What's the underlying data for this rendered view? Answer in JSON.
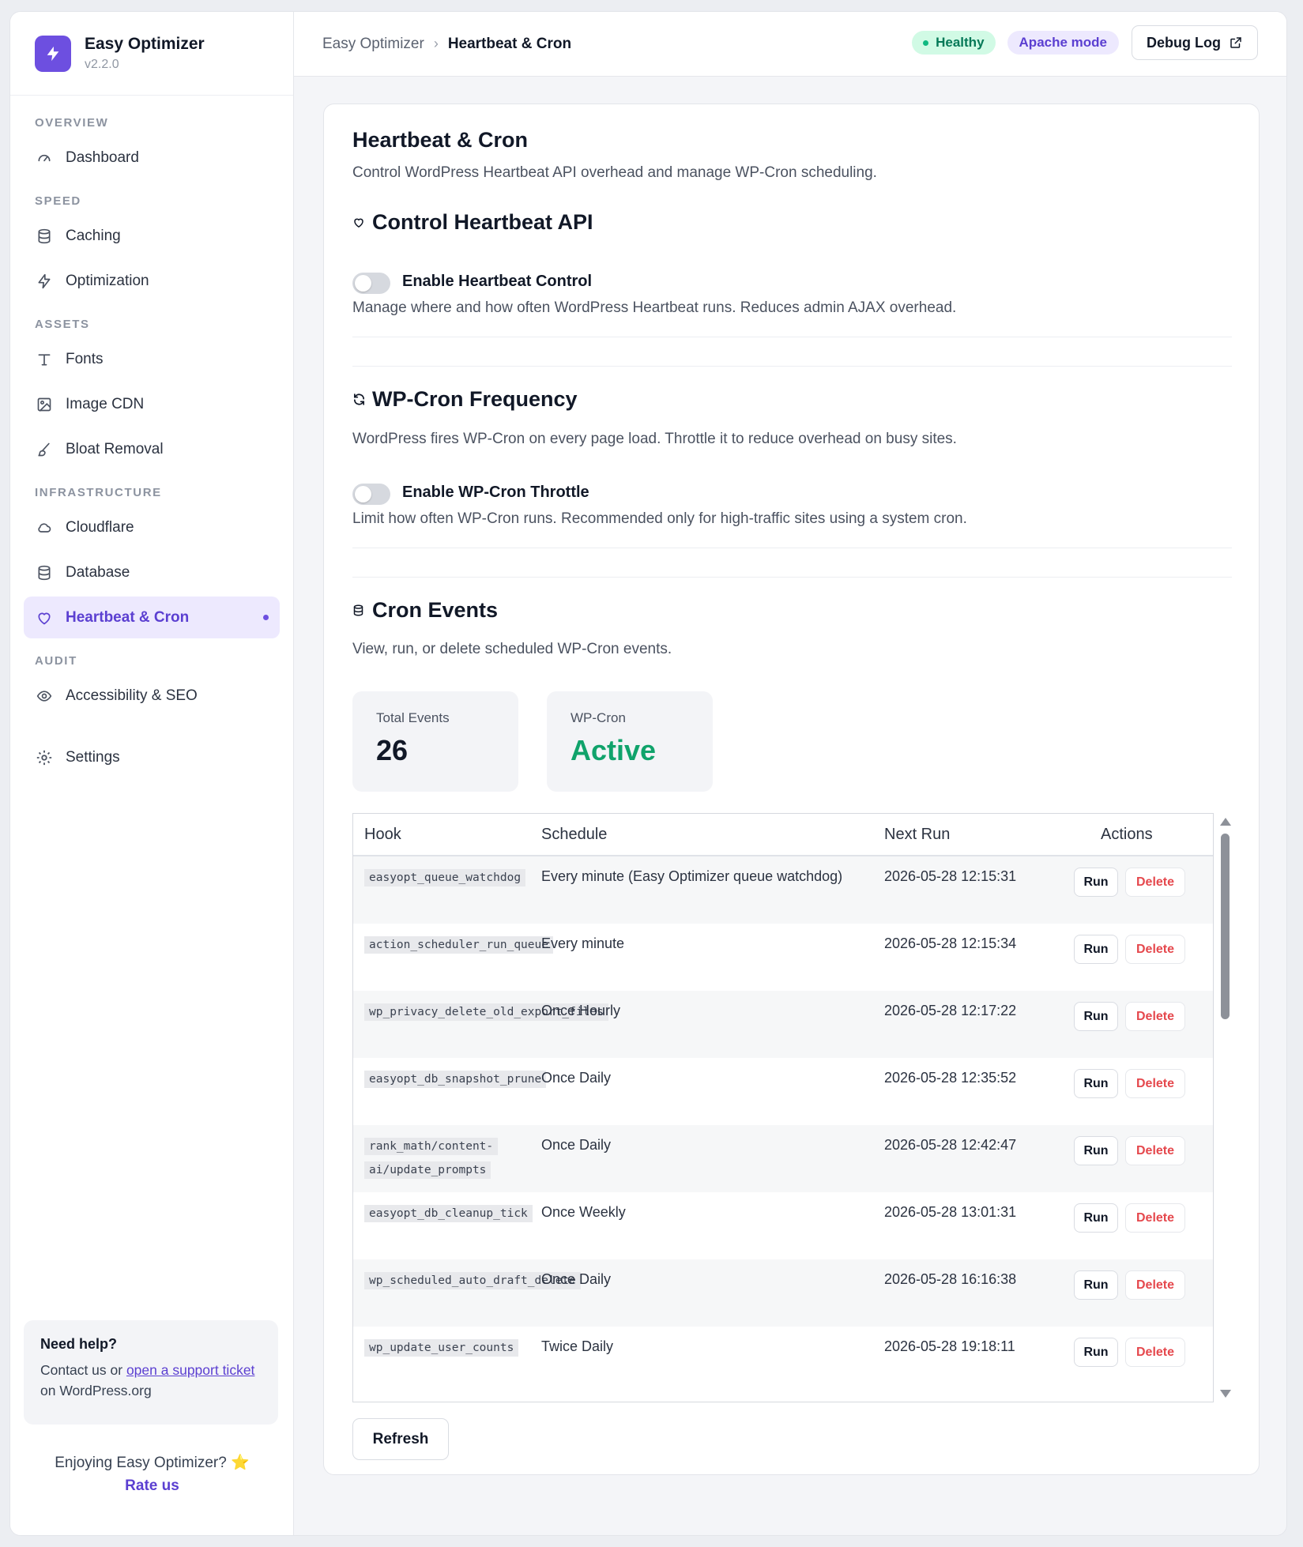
{
  "brand": {
    "name": "Easy Optimizer",
    "version": "v2.2.0"
  },
  "nav": {
    "overview": "OVERVIEW",
    "dashboard": "Dashboard",
    "speed": "SPEED",
    "caching": "Caching",
    "optimization": "Optimization",
    "assets": "ASSETS",
    "fonts": "Fonts",
    "image_cdn": "Image CDN",
    "bloat_removal": "Bloat Removal",
    "infrastructure": "INFRASTRUCTURE",
    "cloudflare": "Cloudflare",
    "database": "Database",
    "heartbeat_cron": "Heartbeat & Cron",
    "audit": "AUDIT",
    "accessibility_seo": "Accessibility & SEO",
    "settings": "Settings"
  },
  "help": {
    "title": "Need help?",
    "text_before": "Contact us or ",
    "link": "open a support ticket",
    "text_after": " on WordPress.org"
  },
  "footer": {
    "enjoy": "Enjoying Easy Optimizer? ⭐",
    "rate": "Rate us"
  },
  "header": {
    "crumb_root": "Easy Optimizer",
    "crumb_sep": "›",
    "crumb_current": "Heartbeat & Cron",
    "status": "Healthy",
    "mode": "Apache mode",
    "debug_log": "Debug Log"
  },
  "page": {
    "title": "Heartbeat & Cron",
    "description": "Control WordPress Heartbeat API overhead and manage WP-Cron scheduling."
  },
  "heartbeat": {
    "title": "Control Heartbeat API",
    "toggle_label": "Enable Heartbeat Control",
    "toggle_desc": "Manage where and how often WordPress Heartbeat runs. Reduces admin AJAX overhead.",
    "enabled": false
  },
  "wpcron": {
    "title": "WP-Cron Frequency",
    "description": "WordPress fires WP-Cron on every page load. Throttle it to reduce overhead on busy sites.",
    "toggle_label": "Enable WP-Cron Throttle",
    "toggle_desc": "Limit how often WP-Cron runs. Recommended only for high-traffic sites using a system cron.",
    "enabled": false
  },
  "cron_events": {
    "title": "Cron Events",
    "description": "View, run, or delete scheduled WP-Cron events.",
    "stats": {
      "total_label": "Total Events",
      "total_value": "26",
      "wpcron_label": "WP-Cron",
      "wpcron_value": "Active"
    },
    "columns": {
      "hook": "Hook",
      "schedule": "Schedule",
      "next_run": "Next Run",
      "actions": "Actions"
    },
    "run_label": "Run",
    "delete_label": "Delete",
    "rows": [
      {
        "hook": "easyopt_queue_watchdog",
        "schedule": "Every minute (Easy Optimizer queue watchdog)",
        "next_run": "2026-05-28 12:15:31"
      },
      {
        "hook": "action_scheduler_run_queue",
        "schedule": "Every minute",
        "next_run": "2026-05-28 12:15:34"
      },
      {
        "hook": "wp_privacy_delete_old_export_files",
        "schedule": "Once Hourly",
        "next_run": "2026-05-28 12:17:22"
      },
      {
        "hook": "easyopt_db_snapshot_prune",
        "schedule": "Once Daily",
        "next_run": "2026-05-28 12:35:52"
      },
      {
        "hook": "rank_math/content-ai/update_prompts",
        "schedule": "Once Daily",
        "next_run": "2026-05-28 12:42:47"
      },
      {
        "hook": "easyopt_db_cleanup_tick",
        "schedule": "Once Weekly",
        "next_run": "2026-05-28 13:01:31"
      },
      {
        "hook": "wp_scheduled_auto_draft_delete",
        "schedule": "Once Daily",
        "next_run": "2026-05-28 16:16:38"
      },
      {
        "hook": "wp_update_user_counts",
        "schedule": "Twice Daily",
        "next_run": "2026-05-28 19:18:11"
      }
    ],
    "refresh": "Refresh"
  },
  "colors": {
    "accent": "#6d4fe0",
    "success": "#10a36b",
    "danger": "#e5484d"
  }
}
